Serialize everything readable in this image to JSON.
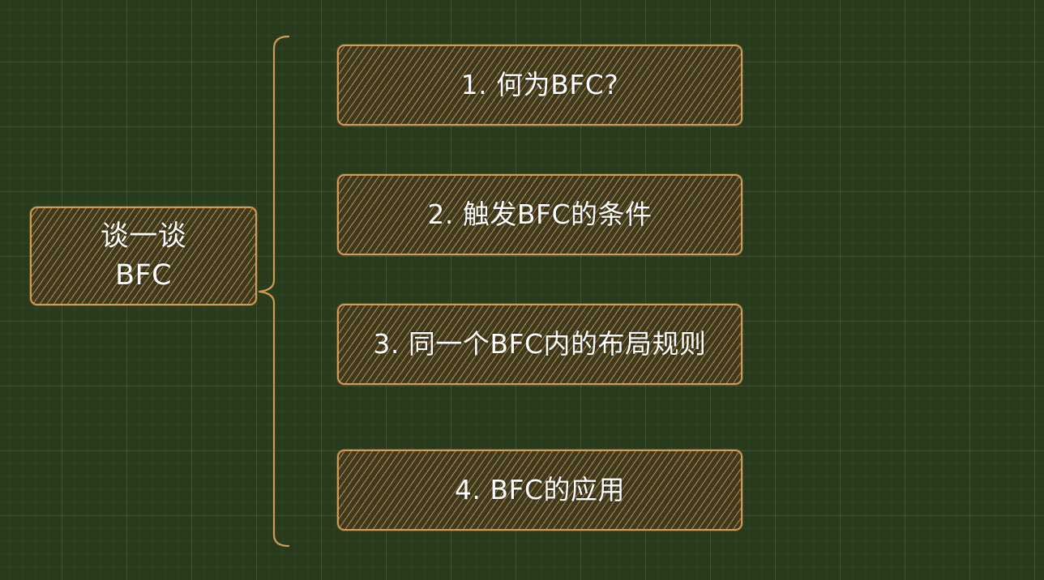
{
  "root": {
    "label": "谈一谈\nBFC"
  },
  "branches": [
    {
      "label": "1. 何为BFC?"
    },
    {
      "label": "2. 触发BFC的条件"
    },
    {
      "label": "3. 同一个BFC内的布局规则"
    },
    {
      "label": "4. BFC的应用"
    }
  ],
  "colors": {
    "background": "#283b1c",
    "stroke": "#d39a54",
    "text": "#ffffff"
  }
}
